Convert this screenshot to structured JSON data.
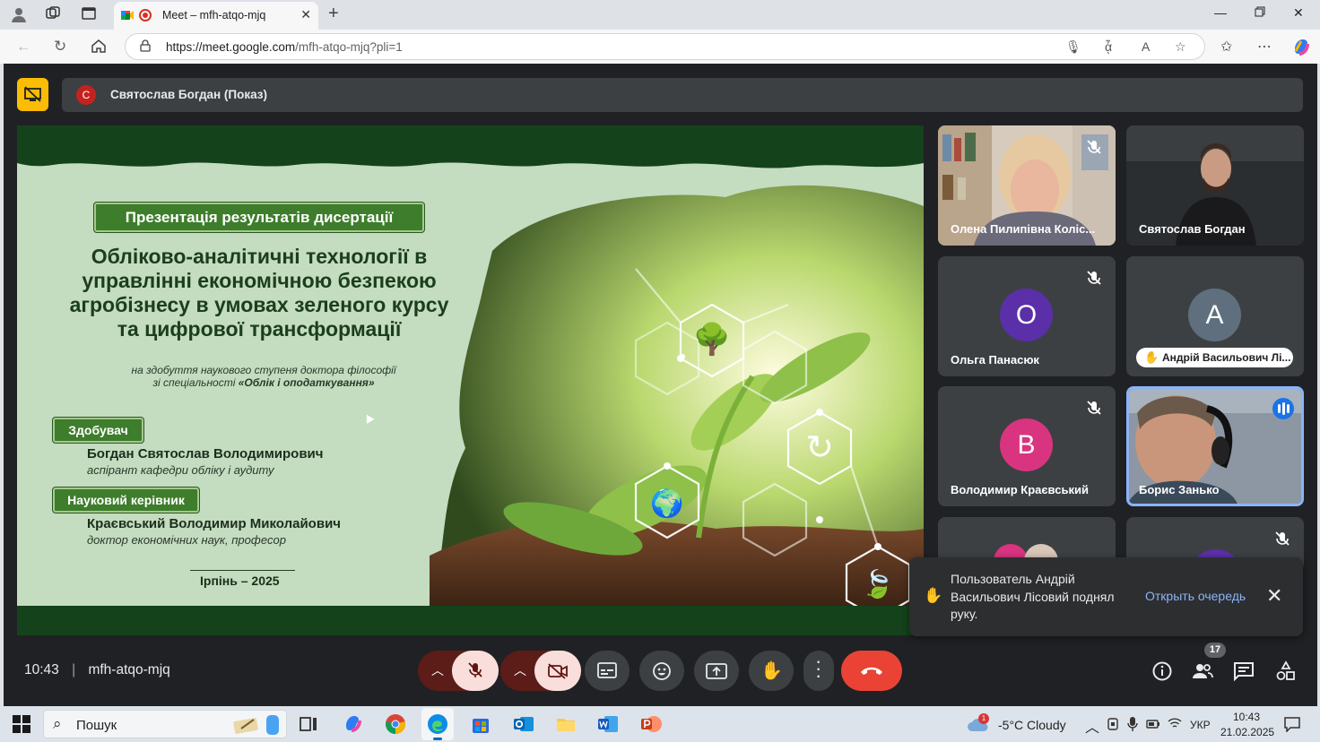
{
  "browser": {
    "tab_title": "Meet – mfh-atqo-mjq",
    "url_host": "https://meet.google.com",
    "url_path": "/mfh-atqo-mjq?pli=1"
  },
  "presenter": {
    "initial": "С",
    "label": "Святослав Богдан (Показ)"
  },
  "slide": {
    "header_badge": "Презентація результатів дисертації",
    "title_lines": [
      "Обліково-аналітичні технології в",
      "управлінні економічною безпекою",
      "агробізнесу в умовах зеленого курсу",
      "та цифрової трансформації"
    ],
    "subtitle_line1": "на здобуття наукового ступеня доктора філософії",
    "subtitle_line2_prefix": "зі спеціальності",
    "subtitle_line2_spec": "«Облік і оподаткування»",
    "applicant_badge": "Здобувач",
    "applicant_name": "Богдан Святослав Володимирович",
    "applicant_role": "аспірант кафедри обліку і аудиту",
    "supervisor_badge": "Науковий керівник",
    "supervisor_name": "Краєвський Володимир Миколайович",
    "supervisor_role": "доктор економічних наук, професор",
    "city_year": "Ірпінь – 2025"
  },
  "participants": [
    {
      "name": "Олена Пилипівна Коліс...",
      "type": "video",
      "muted": true
    },
    {
      "name": "Святослав Богдан",
      "type": "video",
      "muted": false
    },
    {
      "name": "Ольга Панасюк",
      "type": "avatar",
      "initial": "О",
      "color": "#5b2fa8",
      "muted": true
    },
    {
      "name": "Андрій Васильович Лі...",
      "type": "avatar",
      "initial": "А",
      "color": "#5f6f7d",
      "muted": false,
      "hand_raised": true
    },
    {
      "name": "Володимир Краєвський",
      "type": "avatar",
      "initial": "В",
      "color": "#d93480",
      "muted": true
    },
    {
      "name": "Борис Занько",
      "type": "video",
      "speaking": true
    }
  ],
  "toast": {
    "message": "Пользователь Андрій Васильович Лісовий поднял руку.",
    "action": "Открыть очередь"
  },
  "meeting": {
    "time": "10:43",
    "separator": "|",
    "code": "mfh-atqo-mjq",
    "participant_count": "17"
  },
  "taskbar": {
    "search_label": "Пошук",
    "weather": "-5°C  Cloudy",
    "weather_badge": "1",
    "lang": "УКР",
    "time": "10:43",
    "date": "21.02.2025"
  }
}
